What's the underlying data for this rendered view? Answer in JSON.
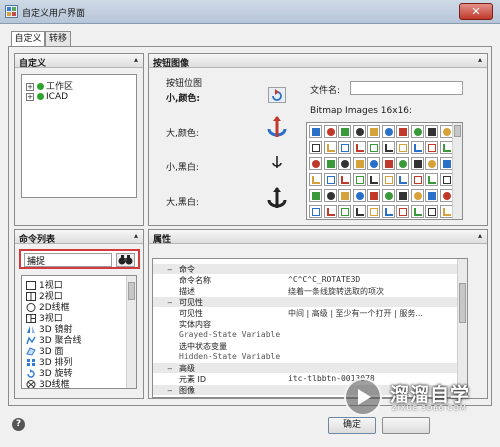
{
  "window": {
    "title": "自定义用户界面",
    "close_glyph": "✕"
  },
  "tabs": [
    {
      "label": "自定义"
    },
    {
      "label": "转移"
    }
  ],
  "customize_panel": {
    "title": "自定义",
    "tree": [
      {
        "expander": "+",
        "label": "工作区"
      },
      {
        "expander": "+",
        "label": "ICAD"
      }
    ]
  },
  "command_list_panel": {
    "title": "命令列表",
    "search_value": "捕捉",
    "search_icon": "binoculars-icon",
    "items": [
      {
        "icon": "square-icon",
        "label": "1视口"
      },
      {
        "icon": "split-icon",
        "label": "2视口"
      },
      {
        "icon": "circle-icon",
        "label": "2D线框"
      },
      {
        "icon": "split3-icon",
        "label": "3视口"
      },
      {
        "icon": "mirror-icon",
        "label": "3D 镜射"
      },
      {
        "icon": "polyline-icon",
        "label": "3D 聚合线"
      },
      {
        "icon": "face-icon",
        "label": "3D 面"
      },
      {
        "icon": "array-icon",
        "label": "3D 排列"
      },
      {
        "icon": "rotate-icon",
        "label": "3D 旋转"
      },
      {
        "icon": "wire-icon",
        "label": "3D线框"
      }
    ]
  },
  "button_image_panel": {
    "title": "按钮图像",
    "preview_group": "按钮位图",
    "small_color": "小,颜色:",
    "large_color": "大,颜色:",
    "small_bw": "小,黑白:",
    "large_bw": "大,黑白:",
    "filename_label": "文件名:",
    "filename_value": "",
    "bitmap_label": "Bitmap Images 16x16:"
  },
  "properties_panel": {
    "title": "属性",
    "rows": [
      {
        "kind": "cat",
        "expander": "−",
        "key": "命令"
      },
      {
        "kind": "prop",
        "key": "命令名称",
        "value": "^C^C^C_ROTATE3D",
        "mono": true
      },
      {
        "kind": "prop",
        "key": "描述",
        "value": "绕着一条线旋转选取的项次",
        "mono": false
      },
      {
        "kind": "cat",
        "expander": "−",
        "key": "可见性"
      },
      {
        "kind": "prop",
        "key": "可见性",
        "value": "中间 | 高级 | 至少有一个打开 | 服务...",
        "mono": false
      },
      {
        "kind": "prop",
        "key": "实体内容",
        "value": "",
        "mono": false
      },
      {
        "kind": "prop",
        "key": "Grayed-State Variable",
        "value": "",
        "mono": false,
        "keymono": true
      },
      {
        "kind": "prop",
        "key": "选中状态变量",
        "value": "",
        "mono": false
      },
      {
        "kind": "prop",
        "key": "Hidden-State Variable",
        "value": "",
        "mono": false,
        "keymono": true
      },
      {
        "kind": "cat",
        "expander": "−",
        "key": "高级"
      },
      {
        "kind": "prop",
        "key": "元素 ID",
        "value": "itc-tlbbtn-0013078",
        "mono": true
      },
      {
        "kind": "cat",
        "expander": "−",
        "key": "图像"
      }
    ]
  },
  "footer": {
    "help_glyph": "?",
    "ok_label": "确定"
  },
  "watermark": {
    "brand": "溜溜自学",
    "url": "ZIXUE.3D66.COM"
  }
}
